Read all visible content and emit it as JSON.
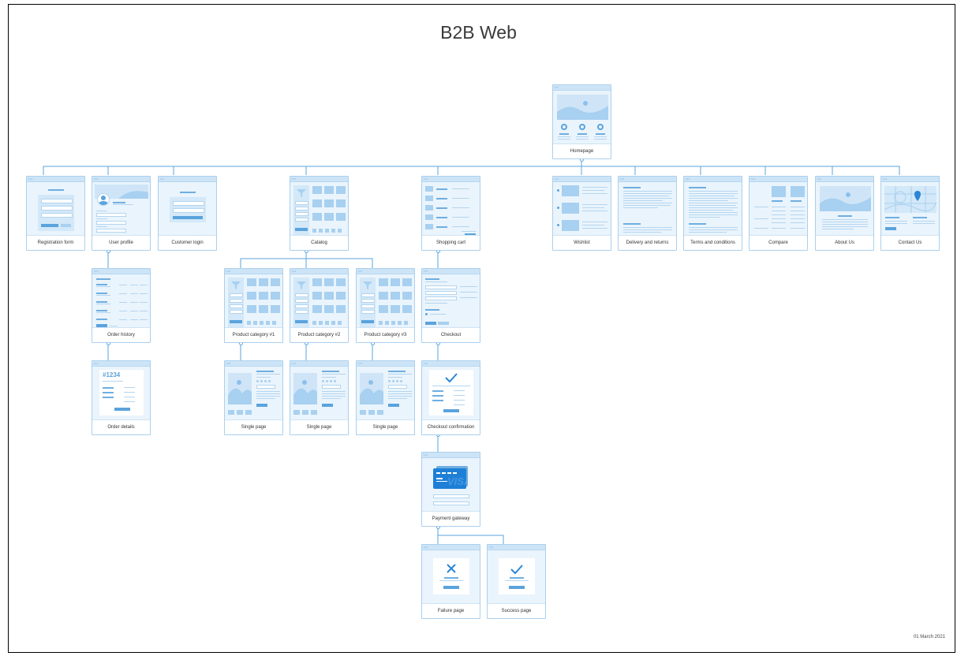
{
  "title": "B2B Web",
  "date": "01 March 2021",
  "window_dots": "•••",
  "colors": {
    "line": "#5aa6de",
    "card": "#eaf4fc",
    "accent": "#4a9be0",
    "frame": "#000000"
  },
  "pages": {
    "homepage": "Homepage",
    "registration_form": "Registration form",
    "user_profile": "User profile",
    "customer_login": "Customer login",
    "catalog": "Catalog",
    "shopping_cart": "Shopping cart",
    "wishlist": "Wishlist",
    "delivery_returns": "Delivery and returns",
    "terms_conditions": "Terms and conditions",
    "compare": "Compare",
    "about_us": "About Us",
    "contact_us": "Contact Us",
    "order_history": "Order history",
    "product_category_1": "Product category #1",
    "product_category_2": "Product category #2",
    "product_category_3": "Product category #3",
    "checkout": "Checkout",
    "order_details": "Order details",
    "single_page_1": "Single page",
    "single_page_2": "Single page",
    "single_page_3": "Single page",
    "checkout_confirmation": "Checkout confirmation",
    "payment_gateway": "Payment gateway",
    "failure_page": "Failure page",
    "success_page": "Success page"
  },
  "order_number": "#1234",
  "card_brand": "VISA",
  "icons": {
    "success": "checkmark-icon",
    "failure": "x-icon",
    "location": "map-pin-icon",
    "filter": "filter-icon"
  }
}
